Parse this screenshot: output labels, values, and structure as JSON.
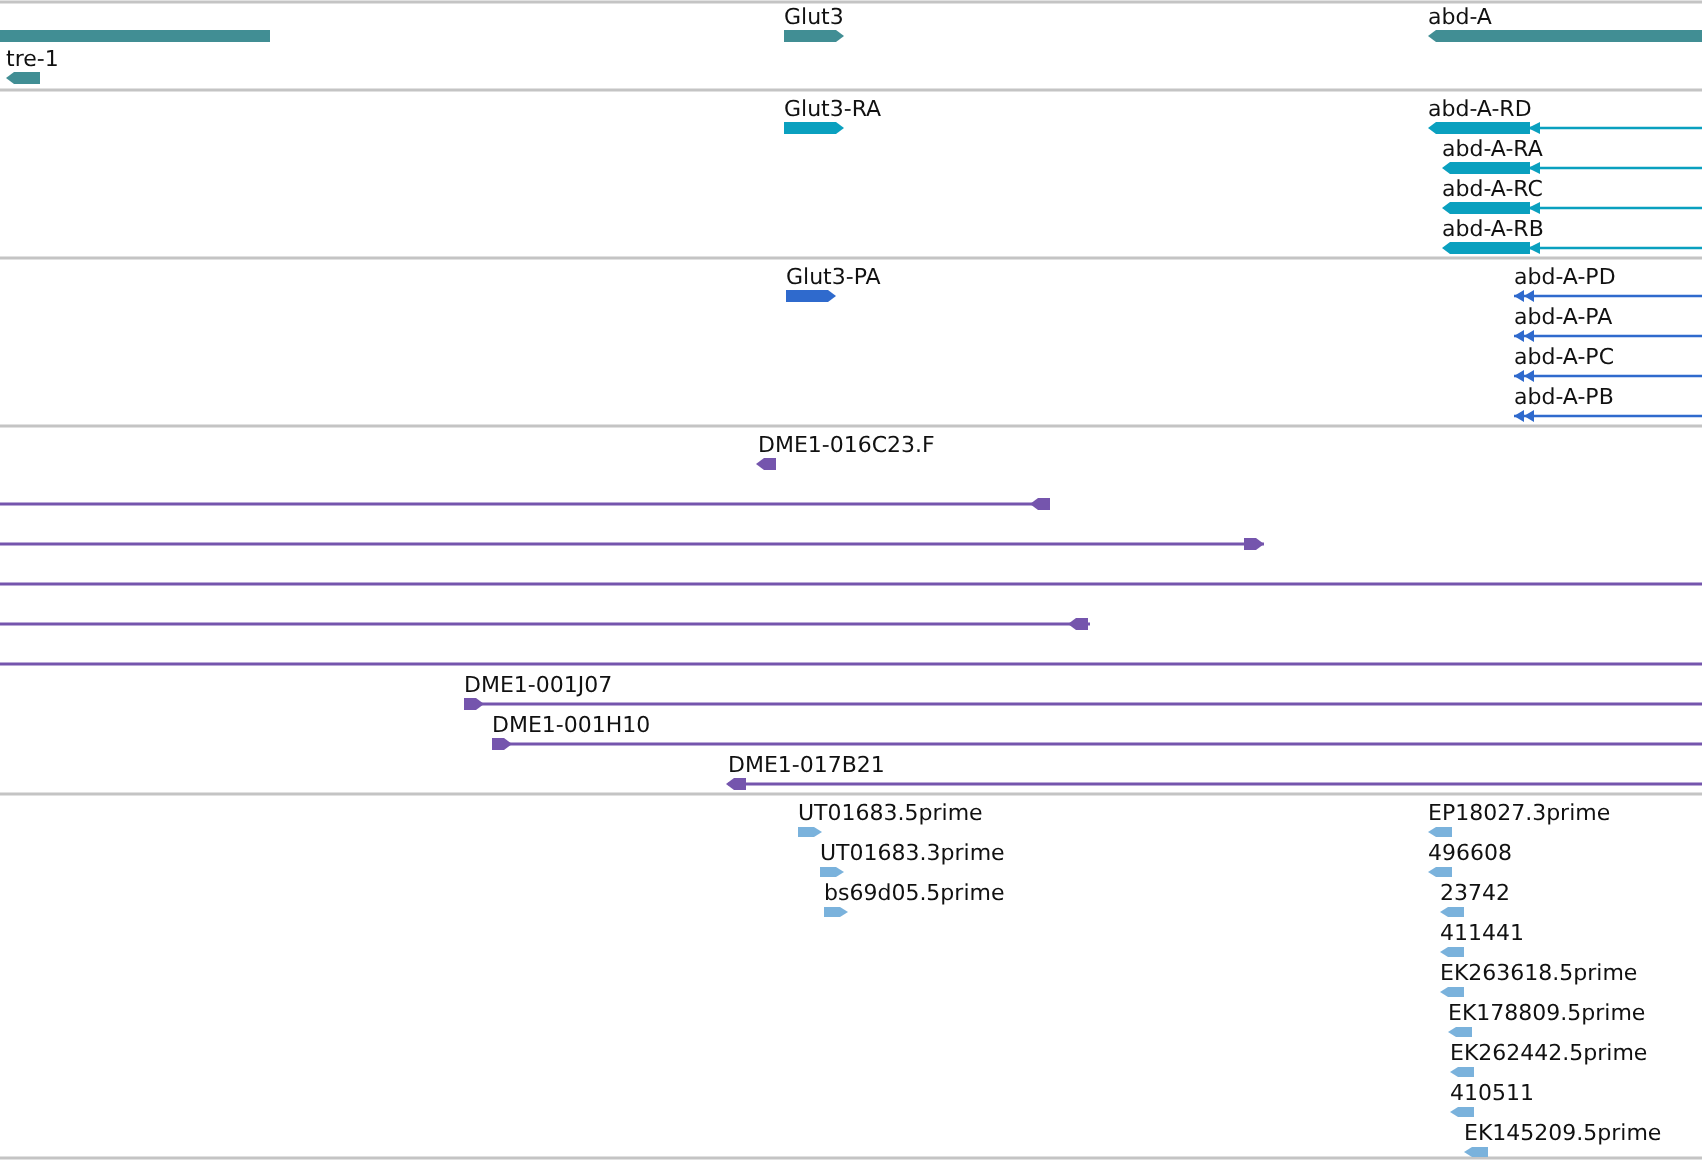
{
  "tracks": [
    {
      "kind": "gene",
      "color": "#418e94",
      "features": [
        {
          "arrowhead": false
        },
        {
          "label": "tre-1",
          "arrowhead": true,
          "reverse": true
        },
        {
          "label": "Glut3",
          "arrowhead": true,
          "reverse": false
        },
        {
          "label": "abd-A",
          "arrowhead": true,
          "reverse": true
        }
      ]
    },
    {
      "kind": "transcript",
      "color": "#0aa0bf",
      "features": [
        {
          "label": "Glut3-RA",
          "arrowhead": true,
          "reverse": false
        },
        {
          "label": "abd-A-RD",
          "arrowhead": true,
          "reverse": true
        },
        {
          "label": "abd-A-RA",
          "arrowhead": true,
          "reverse": true
        },
        {
          "label": "abd-A-RC",
          "arrowhead": true,
          "reverse": true
        },
        {
          "label": "abd-A-RB",
          "arrowhead": true,
          "reverse": true
        }
      ]
    },
    {
      "kind": "protein",
      "color": "#2f6acd",
      "features": [
        {
          "label": "Glut3-PA",
          "arrowhead": true,
          "reverse": false
        },
        {
          "label": "abd-A-PD",
          "arrowhead": true,
          "reverse": true
        },
        {
          "label": "abd-A-PA",
          "arrowhead": true,
          "reverse": true
        },
        {
          "label": "abd-A-PC",
          "arrowhead": true,
          "reverse": true
        },
        {
          "label": "abd-A-PB",
          "arrowhead": true,
          "reverse": true
        }
      ]
    },
    {
      "kind": "clone",
      "color": "#7555ad",
      "features": [
        {
          "label": "DME1-016C23.F",
          "arrowhead": true,
          "reverse": true
        },
        {
          "arrowhead": true,
          "reverse": true
        },
        {
          "arrowhead": true,
          "reverse": false
        },
        {
          "arrowhead": false
        },
        {
          "arrowhead": true,
          "reverse": true
        },
        {
          "arrowhead": false
        },
        {
          "label": "DME1-001J07",
          "arrowhead": true,
          "reverse": false
        },
        {
          "label": "DME1-001H10",
          "arrowhead": true,
          "reverse": false
        },
        {
          "label": "DME1-017B21",
          "arrowhead": true,
          "reverse": true
        }
      ]
    },
    {
      "kind": "est",
      "color": "#7ab2dc",
      "features": [
        {
          "label": "UT01683.5prime",
          "arrowhead": true,
          "reverse": false
        },
        {
          "label": "UT01683.3prime",
          "arrowhead": true,
          "reverse": false
        },
        {
          "label": "bs69d05.5prime",
          "arrowhead": true,
          "reverse": false
        },
        {
          "label": "EP18027.3prime",
          "arrowhead": true,
          "reverse": true
        },
        {
          "label": "496608",
          "arrowhead": true,
          "reverse": true
        },
        {
          "label": "23742",
          "arrowhead": true,
          "reverse": true
        },
        {
          "label": "411441",
          "arrowhead": true,
          "reverse": true
        },
        {
          "label": "EK263618.5prime",
          "arrowhead": true,
          "reverse": true
        },
        {
          "label": "EK178809.5prime",
          "arrowhead": true,
          "reverse": true
        },
        {
          "label": "EK262442.5prime",
          "arrowhead": true,
          "reverse": true
        },
        {
          "label": "410511",
          "arrowhead": true,
          "reverse": true
        },
        {
          "label": "EK145209.5prime",
          "arrowhead": true,
          "reverse": true
        }
      ]
    }
  ]
}
